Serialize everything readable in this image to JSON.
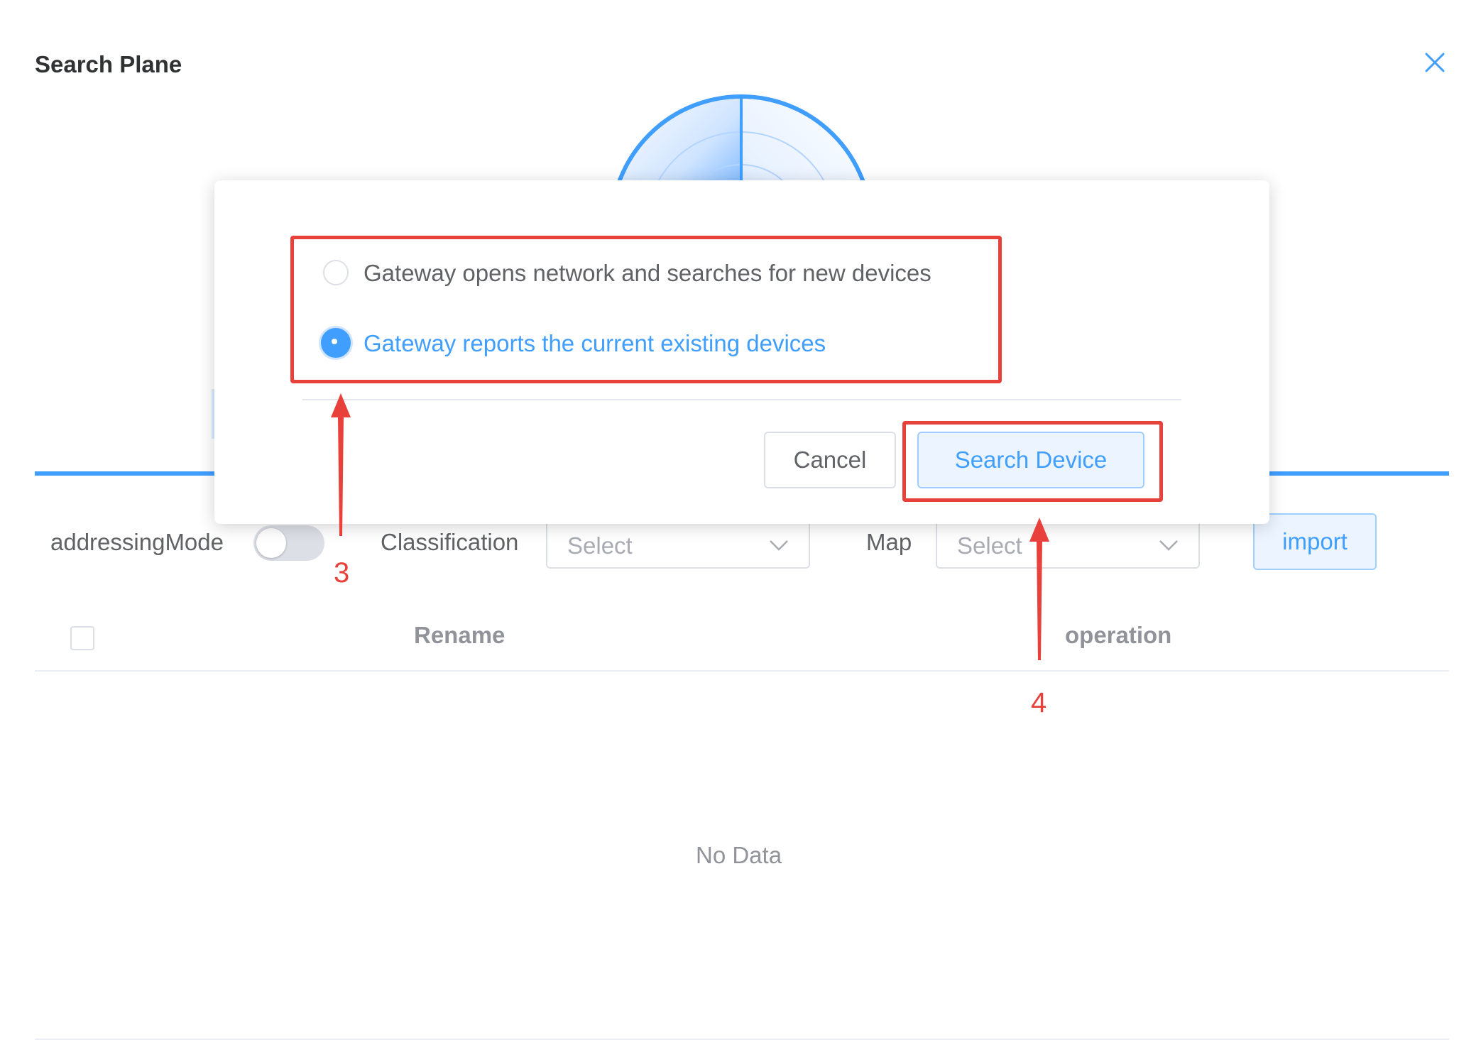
{
  "panel": {
    "title": "Search Plane"
  },
  "dialog": {
    "options": [
      {
        "label": "Gateway opens network and searches for new devices",
        "selected": false
      },
      {
        "label": "Gateway reports the current existing devices",
        "selected": true
      }
    ],
    "cancel_label": "Cancel",
    "search_label": "Search Device"
  },
  "filters": {
    "addressing_mode_label": "addressingMode",
    "addressing_mode_on": false,
    "classification_label": "Classification",
    "classification_placeholder": "Select",
    "map_label": "Map",
    "map_placeholder": "Select",
    "import_label": "import"
  },
  "table": {
    "columns": [
      "Rename",
      "operation"
    ],
    "empty_text": "No Data"
  },
  "annotations": {
    "step_3": "3",
    "step_4": "4"
  },
  "colors": {
    "accent": "#409eff",
    "annotation": "#e8413b"
  }
}
